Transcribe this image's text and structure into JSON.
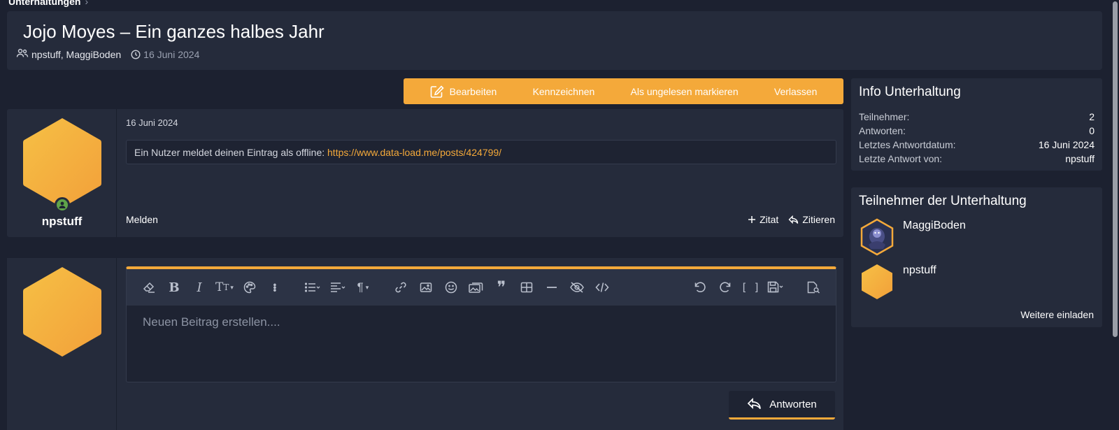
{
  "breadcrumb": {
    "label": "Unterhaltungen"
  },
  "header": {
    "title": "Jojo Moyes – Ein ganzes halbes Jahr",
    "participants": "npstuff, MaggiBoden",
    "date": "16 Juni 2024"
  },
  "actions": {
    "edit": "Bearbeiten",
    "flag": "Kennzeichnen",
    "mark_unread": "Als ungelesen markieren",
    "leave": "Verlassen"
  },
  "message": {
    "author": "npstuff",
    "date": "16 Juni 2024",
    "text": "Ein Nutzer meldet deinen Eintrag als offline:",
    "link": "https://www.data-load.me/posts/424799/",
    "report": "Melden",
    "quote_plus": "Zitat",
    "quote": "Zitieren"
  },
  "reply": {
    "placeholder": "Neuen Beitrag erstellen....",
    "submit": "Antworten"
  },
  "info": {
    "title": "Info Unterhaltung",
    "rows": [
      {
        "label": "Teilnehmer:",
        "value": "2"
      },
      {
        "label": "Antworten:",
        "value": "0"
      },
      {
        "label": "Letztes Antwortdatum:",
        "value": "16 Juni 2024"
      },
      {
        "label": "Letzte Antwort von:",
        "value": "npstuff"
      }
    ]
  },
  "participants": {
    "title": "Teilnehmer der Unterhaltung",
    "items": [
      {
        "name": "MaggiBoden"
      },
      {
        "name": "npstuff"
      }
    ],
    "invite": "Weitere einladen"
  },
  "colors": {
    "accent": "#f4a93a",
    "background": "#1c2130",
    "panel": "#252b3b",
    "online": "#5fa44a"
  }
}
